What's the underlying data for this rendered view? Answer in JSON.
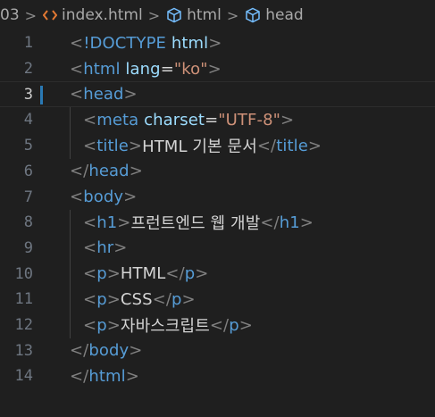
{
  "breadcrumb": {
    "folder": "03",
    "file": "index.html",
    "item1": "html",
    "item2": "head"
  },
  "lines": [
    {
      "num": "1"
    },
    {
      "num": "2",
      "lang_value": "\"ko\""
    },
    {
      "num": "3"
    },
    {
      "num": "4",
      "charset_value": "\"UTF-8\""
    },
    {
      "num": "5",
      "text": "HTML 기본 문서"
    },
    {
      "num": "6"
    },
    {
      "num": "7"
    },
    {
      "num": "8",
      "text": "프런트엔드 웹 개발"
    },
    {
      "num": "9"
    },
    {
      "num": "10",
      "text": "HTML"
    },
    {
      "num": "11",
      "text": "CSS"
    },
    {
      "num": "12",
      "text": "자바스크립트"
    },
    {
      "num": "13"
    },
    {
      "num": "14"
    }
  ],
  "syntax_colors": {
    "punctuation": "#808080",
    "tag": "#569cd6",
    "attribute": "#9cdcfe",
    "string": "#ce9178",
    "text": "#d4d4d4",
    "background": "#1f1f1f",
    "active_line_marker": "#2a79b4"
  },
  "icons": {
    "file_icon": "html-file-icon",
    "element_icon": "cube-icon"
  }
}
